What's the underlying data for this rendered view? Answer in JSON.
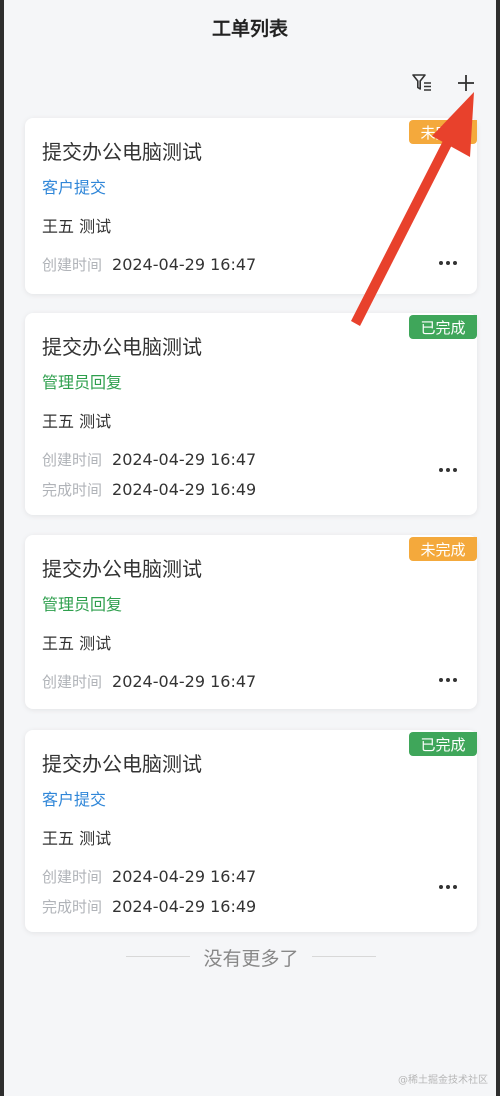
{
  "header": {
    "title": "工单列表"
  },
  "tickets": [
    {
      "title": "提交办公电脑测试",
      "type": "客户提交",
      "type_color": "#2f86d8",
      "description": "王五 测试",
      "created_label": "创建时间",
      "created_value": "2024-04-29 16:47",
      "status": "未完成",
      "status_color": "#f4a93c"
    },
    {
      "title": "提交办公电脑测试",
      "type": "管理员回复",
      "type_color": "#2e9f4d",
      "description": "王五 测试",
      "created_label": "创建时间",
      "created_value": "2024-04-29 16:47",
      "completed_label": "完成时间",
      "completed_value": "2024-04-29 16:49",
      "status": "已完成",
      "status_color": "#3fa65a"
    },
    {
      "title": "提交办公电脑测试",
      "type": "管理员回复",
      "type_color": "#2e9f4d",
      "description": "王五 测试",
      "created_label": "创建时间",
      "created_value": "2024-04-29 16:47",
      "status": "未完成",
      "status_color": "#f4a93c"
    },
    {
      "title": "提交办公电脑测试",
      "type": "客户提交",
      "type_color": "#2f86d8",
      "description": "王五 测试",
      "created_label": "创建时间",
      "created_value": "2024-04-29 16:47",
      "completed_label": "完成时间",
      "completed_value": "2024-04-29 16:49",
      "status": "已完成",
      "status_color": "#3fa65a"
    }
  ],
  "footer": {
    "text": "没有更多了"
  },
  "watermark": "@稀土掘金技术社区",
  "icons": {
    "filter": "filter-list-icon",
    "add": "plus-icon",
    "more": "more-dots-icon"
  },
  "annotation": {
    "arrow_color": "#e8412c"
  }
}
